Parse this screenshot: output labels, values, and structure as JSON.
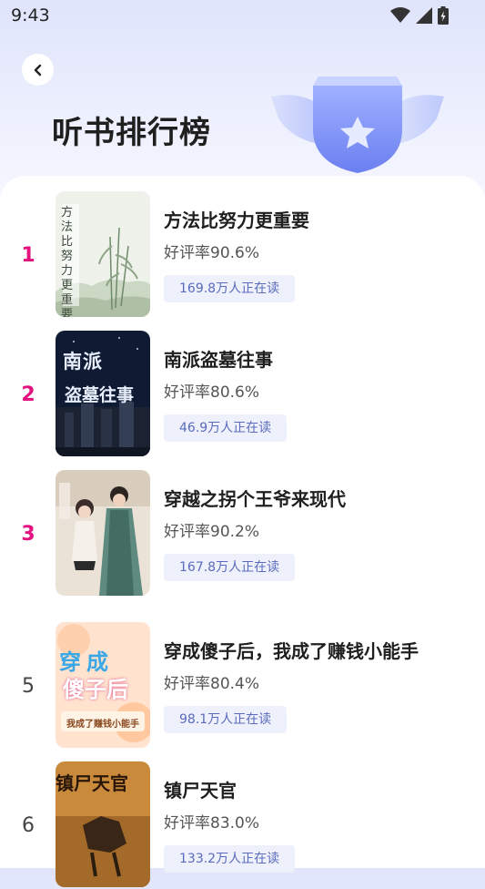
{
  "status": {
    "time": "9:43"
  },
  "header": {
    "title": "听书排行榜"
  },
  "books": [
    {
      "rank": "1",
      "title": "方法比努力更重要",
      "rating": "好评率90.6%",
      "reading": "169.8万人正在读",
      "cover_text": "方法比努力更重要"
    },
    {
      "rank": "2",
      "title": "南派盗墓往事",
      "rating": "好评率80.6%",
      "reading": "46.9万人正在读",
      "cover_text_1": "南派",
      "cover_text_2": "盗墓往事"
    },
    {
      "rank": "3",
      "title": "穿越之拐个王爷来现代",
      "rating": "好评率90.2%",
      "reading": "167.8万人正在读"
    },
    {
      "rank": "5",
      "title": "穿成傻子后，我成了赚钱小能手",
      "rating": "好评率80.4%",
      "reading": "98.1万人正在读",
      "cover_text_1": "穿成",
      "cover_text_2": "傻子后",
      "cover_text_3": "我成了赚钱小能手"
    },
    {
      "rank": "6",
      "title": "镇尸天官",
      "rating": "好评率83.0%",
      "reading": "133.2万人正在读",
      "cover_text": "镇尸天官"
    }
  ],
  "colors": {
    "accent_rank": "#e3127e",
    "badge_bg": "#eef0fb",
    "badge_text": "#5a6bbd"
  }
}
